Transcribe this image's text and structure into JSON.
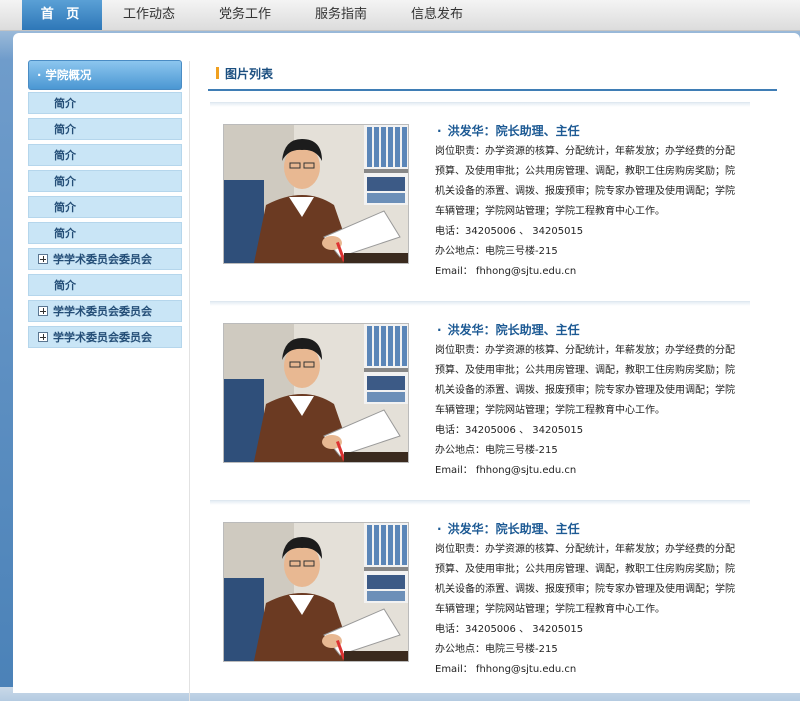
{
  "nav": {
    "items": [
      {
        "label": "首 页"
      },
      {
        "label": "工作动态"
      },
      {
        "label": "党务工作"
      },
      {
        "label": "服务指南"
      },
      {
        "label": "信息发布"
      }
    ]
  },
  "sidebar": {
    "title": "· 学院概况",
    "items": [
      {
        "label": "简介"
      },
      {
        "label": "简介"
      },
      {
        "label": "简介"
      },
      {
        "label": "简介"
      },
      {
        "label": "简介"
      },
      {
        "label": "简介"
      },
      {
        "label": "学学术委员会委员会"
      },
      {
        "label": "简介"
      },
      {
        "label": "学学术委员会委员会"
      },
      {
        "label": "学学术委员会委员会"
      }
    ]
  },
  "main": {
    "title": "图片列表",
    "cards": [
      {
        "name": "洪发华：院长助理、主任",
        "duties": "岗位职责：办学资源的核算、分配统计，年薪发放；办学经费的分配预算、及使用审批；公共用房管理、调配，教职工住房购房奖励；院机关设备的添置、调拨、报废预审；院专家办管理及使用调配；学院车辆管理；学院网站管理；学院工程教育中心工作。",
        "phone": "电话：34205006 、 34205015",
        "office": "办公地点：电院三号楼-215",
        "email": "Email： fhhong@sjtu.edu.cn"
      },
      {
        "name": "洪发华：院长助理、主任",
        "duties": "岗位职责：办学资源的核算、分配统计，年薪发放；办学经费的分配预算、及使用审批；公共用房管理、调配，教职工住房购房奖励；院机关设备的添置、调拨、报废预审；院专家办管理及使用调配；学院车辆管理；学院网站管理；学院工程教育中心工作。",
        "phone": "电话：34205006 、 34205015",
        "office": "办公地点：电院三号楼-215",
        "email": "Email： fhhong@sjtu.edu.cn"
      },
      {
        "name": "洪发华：院长助理、主任",
        "duties": "岗位职责：办学资源的核算、分配统计，年薪发放；办学经费的分配预算、及使用审批；公共用房管理、调配，教职工住房购房奖励；院机关设备的添置、调拨、报废预审；院专家办管理及使用调配；学院车辆管理；学院网站管理；学院工程教育中心工作。",
        "phone": "电话：34205006 、 34205015",
        "office": "办公地点：电院三号楼-215",
        "email": "Email： fhhong@sjtu.edu.cn"
      }
    ]
  },
  "colors": {
    "nav_active": "#2e77b8",
    "sidebar_item_bg": "#c9e5f6",
    "accent_bar": "#f0a020",
    "name_text": "#1d5a94"
  }
}
